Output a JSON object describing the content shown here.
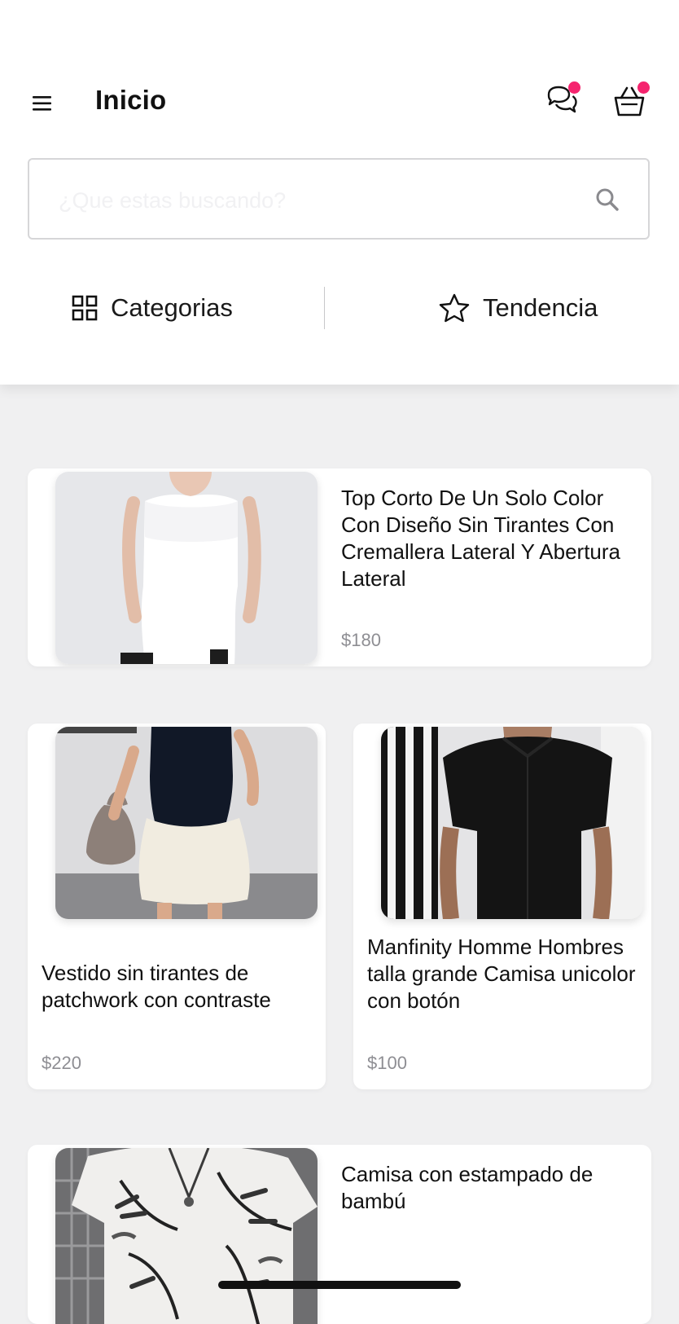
{
  "header": {
    "title": "Inicio",
    "accent_color": "#f5246e",
    "icons": [
      "menu-icon",
      "chat-icon",
      "cart-icon"
    ]
  },
  "search": {
    "placeholder": "¿Que estas buscando?",
    "value": ""
  },
  "tabs": [
    {
      "label": "Categorias",
      "icon": "grid-icon"
    },
    {
      "label": "Tendencia",
      "icon": "star-icon"
    }
  ],
  "products": [
    {
      "title": "Top Corto De Un Solo Color Con Diseño Sin Tirantes Con Cremallera Lateral Y Abertura Lateral",
      "price": "$180"
    },
    {
      "title": "Vestido sin tirantes de patchwork con contraste",
      "price": "$220"
    },
    {
      "title": "Manfinity Homme Hombres talla grande Camisa unicolor con botón",
      "price": "$100"
    },
    {
      "title": "Camisa con estampado de bambú",
      "price": ""
    }
  ]
}
